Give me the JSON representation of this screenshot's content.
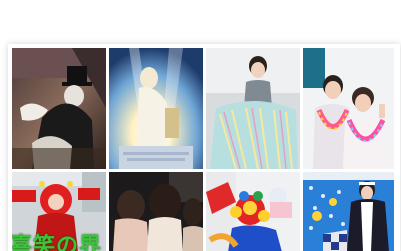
{
  "gallery": {
    "tiles": [
      {
        "alt": "magician-with-top-hat-photo"
      },
      {
        "alt": "glowing-deity-illustration"
      },
      {
        "alt": "woman-with-sparkle-skirt-photo"
      },
      {
        "alt": "two-women-with-leis-photo"
      },
      {
        "alt": "red-costume-character-photo",
        "caption": "喜笑の界"
      },
      {
        "alt": "children-from-behind-photo"
      },
      {
        "alt": "colorful-balloon-performer-photo"
      },
      {
        "alt": "performer-with-blue-backdrop-photo"
      }
    ]
  }
}
